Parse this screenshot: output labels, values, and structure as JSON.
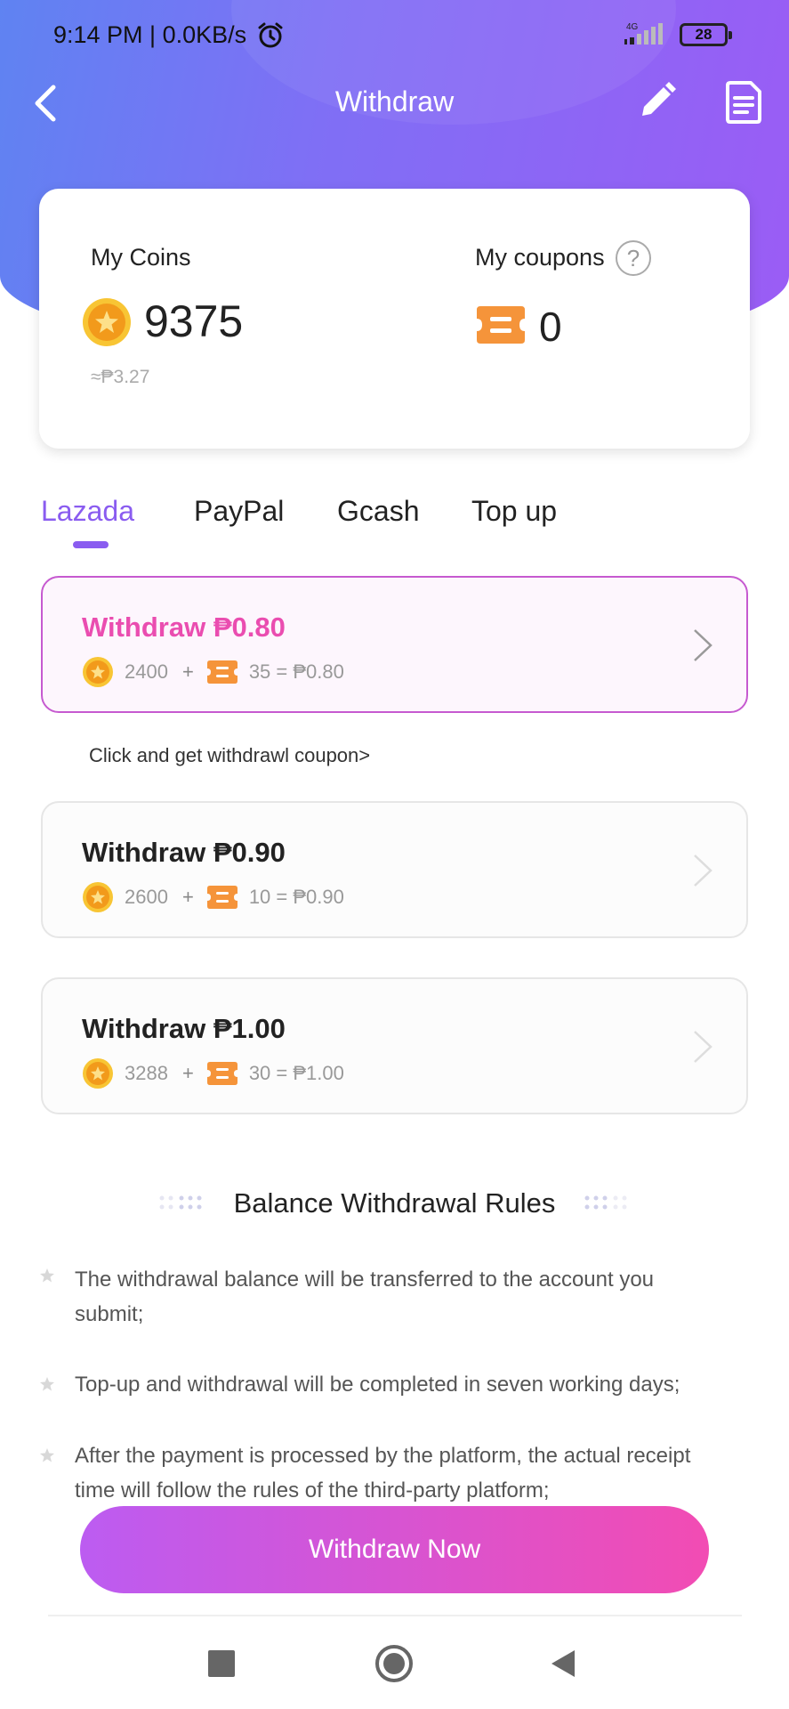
{
  "status_bar": {
    "time": "9:14 PM | 0.0KB/s",
    "network": "4G",
    "battery": "28"
  },
  "nav": {
    "title": "Withdraw"
  },
  "wallet": {
    "coins_label": "My Coins",
    "coins_value": "9375",
    "coins_approx": "≈₱3.27",
    "coupons_label": "My coupons",
    "help_symbol": "?",
    "coupons_value": "0"
  },
  "tabs": [
    {
      "label": "Lazada",
      "active": true
    },
    {
      "label": "PayPal",
      "active": false
    },
    {
      "label": "Gcash",
      "active": false
    },
    {
      "label": "Top up",
      "active": false
    }
  ],
  "options": [
    {
      "title": "Withdraw ₱0.80",
      "coins": "2400",
      "plus": "+",
      "coupons": "35 = ₱0.80",
      "selected": true
    },
    {
      "title": "Withdraw ₱0.90",
      "coins": "2600",
      "plus": "+",
      "coupons": "10 = ₱0.90",
      "selected": false
    },
    {
      "title": "Withdraw ₱1.00",
      "coins": "3288",
      "plus": "+",
      "coupons": "30 = ₱1.00",
      "selected": false
    }
  ],
  "coupon_link": "Click and get withdrawl coupon>",
  "rules": {
    "title": "Balance Withdrawal Rules",
    "items": [
      "The withdrawal balance will be transferred to the account you submit;",
      "Top-up and withdrawal will be completed in seven working days;",
      "After the payment is processed by the platform, the actual receipt time will follow the rules of the third-party platform;"
    ]
  },
  "withdraw_button": "Withdraw Now",
  "colors": {
    "header_gradient_start": "#5f83f2",
    "header_gradient_end": "#9b5cf5",
    "accent_purple": "#8a5cf0",
    "selected_pink": "#ea4db0",
    "coin_gold": "#f5b21c",
    "coupon_orange": "#f5943a",
    "button_gradient_start": "#bc5cf1",
    "button_gradient_end": "#f24cb3"
  },
  "icons": [
    "back-arrow-icon",
    "edit-pencil-icon",
    "document-icon",
    "coin-icon",
    "coupon-ticket-icon",
    "help-icon",
    "chevron-right-icon",
    "star-bullet-icon"
  ]
}
